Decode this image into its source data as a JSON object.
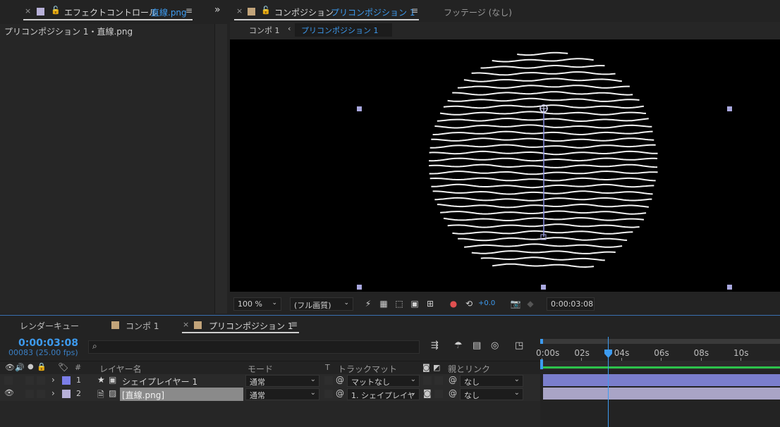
{
  "effect_panel": {
    "tab_title": "エフェクトコントロール",
    "tab_target": "直線.png",
    "expand_glyph": "»",
    "breadcrumb": "プリコンポジション 1・直線.png"
  },
  "comp_panel": {
    "tab_prefix": "コンポジション",
    "tab_name": "プリコンポジション 1",
    "footage_tab": "フッテージ (なし)",
    "flow_items": [
      "コンポ 1",
      "プリコンポジション 1"
    ]
  },
  "viewer_toolbar": {
    "zoom": "100 %",
    "resolution": "(フル画質)",
    "exposure": "+0.0",
    "timecode": "0:00:03:08"
  },
  "timeline": {
    "tabs": [
      "レンダーキュー",
      "コンポ 1",
      "プリコンポジション 1"
    ],
    "current_time": "0:00:03:08",
    "frame_info": "00083 (25.00 fps)",
    "search_placeholder": "",
    "columns": {
      "num": "#",
      "layer_name": "レイヤー名",
      "mode": "モード",
      "t": "T",
      "track_matte": "トラックマット",
      "parent": "親とリンク"
    },
    "ruler": [
      "0:00s",
      "02s",
      "04s",
      "06s",
      "08s",
      "10s"
    ],
    "playhead_seconds": 3.32,
    "layers": [
      {
        "index": "1",
        "name": "シェイプレイヤー 1",
        "mode": "通常",
        "matte": "マットなし",
        "parent": "なし",
        "color": "#7b7ee8"
      },
      {
        "index": "2",
        "name": "[直線.png]",
        "mode": "通常",
        "matte": "1. シェイプレイヤ",
        "parent": "なし",
        "color": "#b7b0d8"
      }
    ]
  },
  "colors": {
    "accent": "#3d9bf0",
    "shape_label": "#7b7ee8",
    "footage_label": "#b7b0d8",
    "tab_swatch": "#c2a47a"
  }
}
